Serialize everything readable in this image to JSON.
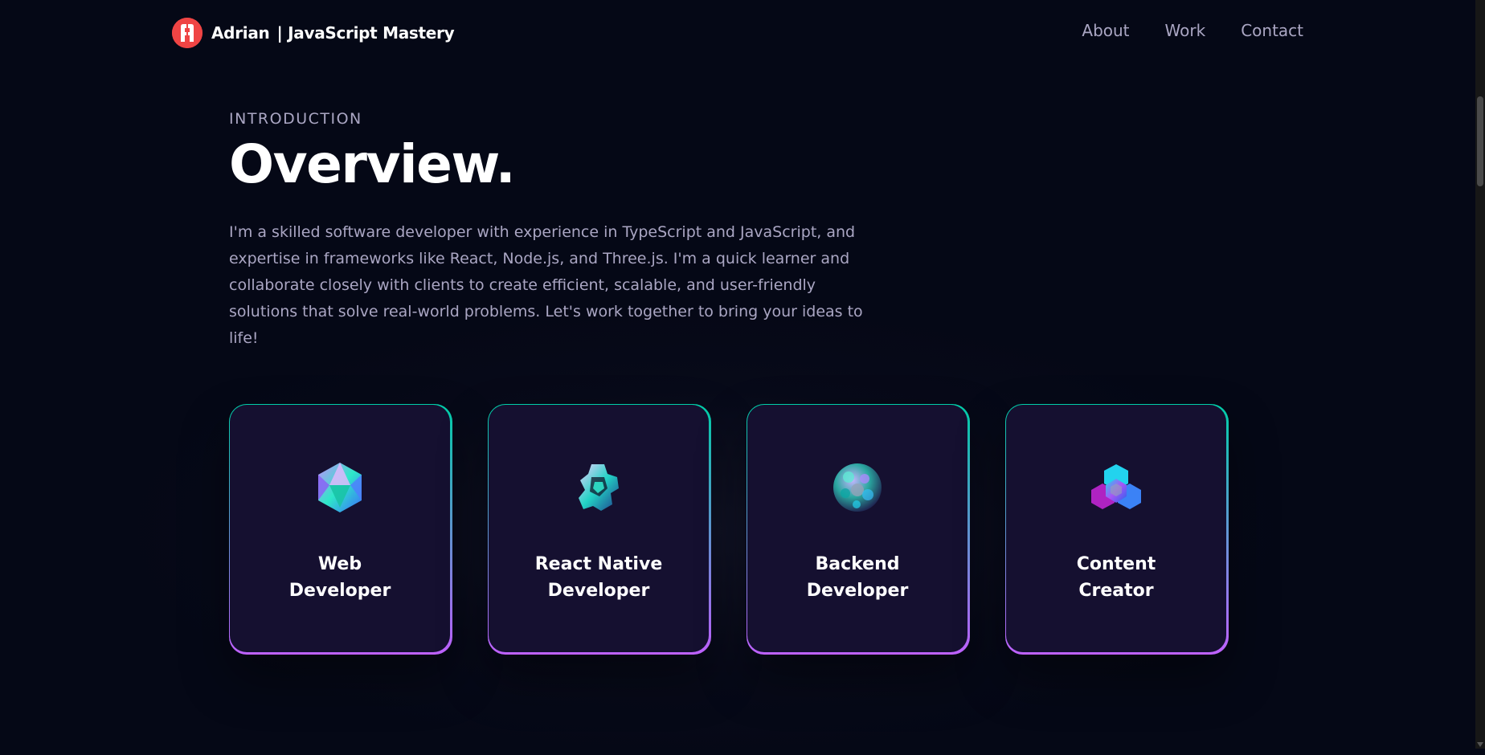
{
  "navbar": {
    "brand_name": "Adrian",
    "brand_tagline": "| JavaScript Mastery",
    "links": [
      {
        "label": "About"
      },
      {
        "label": "Work"
      },
      {
        "label": "Contact"
      }
    ]
  },
  "intro": {
    "subtitle": "INTRODUCTION",
    "title": "Overview.",
    "description": "I'm a skilled software developer with experience in TypeScript and JavaScript, and expertise in frameworks like React, Node.js, and Three.js. I'm a quick learner and collaborate closely with clients to create efficient, scalable, and user-friendly solutions that solve real-world problems. Let's work together to bring your ideas to life!"
  },
  "services": [
    {
      "line1": "Web",
      "line2": "Developer",
      "icon": "web-icon"
    },
    {
      "line1": "React Native",
      "line2": "Developer",
      "icon": "mobile-icon"
    },
    {
      "line1": "Backend",
      "line2": "Developer",
      "icon": "backend-icon"
    },
    {
      "line1": "Content",
      "line2": "Creator",
      "icon": "creator-icon"
    }
  ],
  "colors": {
    "background": "#050816",
    "card": "#151030",
    "secondary_text": "#aaa6c3",
    "border_start": "#00cea8",
    "border_end": "#bf61ff",
    "logo": "#ef4444"
  }
}
